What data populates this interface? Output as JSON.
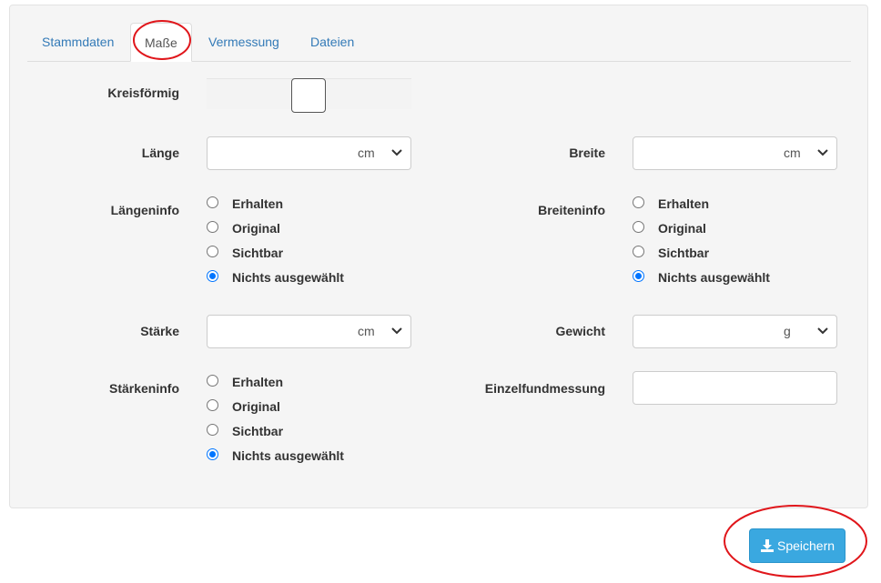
{
  "tabs": [
    {
      "label": "Stammdaten",
      "active": false
    },
    {
      "label": "Maße",
      "active": true
    },
    {
      "label": "Vermessung",
      "active": false
    },
    {
      "label": "Dateien",
      "active": false
    }
  ],
  "form": {
    "kreisfoermig_label": "Kreisförmig",
    "laenge": {
      "label": "Länge",
      "value": "",
      "unit": "cm"
    },
    "breite": {
      "label": "Breite",
      "value": "",
      "unit": "cm"
    },
    "laengeninfo": {
      "label": "Längeninfo",
      "options": [
        "Erhalten",
        "Original",
        "Sichtbar",
        "Nichts ausgewählt"
      ],
      "selected": "Nichts ausgewählt"
    },
    "breiteninfo": {
      "label": "Breiteninfo",
      "options": [
        "Erhalten",
        "Original",
        "Sichtbar",
        "Nichts ausgewählt"
      ],
      "selected": "Nichts ausgewählt"
    },
    "staerke": {
      "label": "Stärke",
      "value": "",
      "unit": "cm"
    },
    "gewicht": {
      "label": "Gewicht",
      "value": "",
      "unit": "g"
    },
    "staerkeninfo": {
      "label": "Stärkeninfo",
      "options": [
        "Erhalten",
        "Original",
        "Sichtbar",
        "Nichts ausgewählt"
      ],
      "selected": "Nichts ausgewählt"
    },
    "einzelfundmessung": {
      "label": "Einzelfundmessung",
      "value": ""
    }
  },
  "save_button": {
    "label": "Speichern",
    "icon": "download-icon"
  },
  "colors": {
    "accent": "#337ab7",
    "button": "#3aa8e0",
    "radio": "#0075ff",
    "annotation": "#e0161b"
  }
}
